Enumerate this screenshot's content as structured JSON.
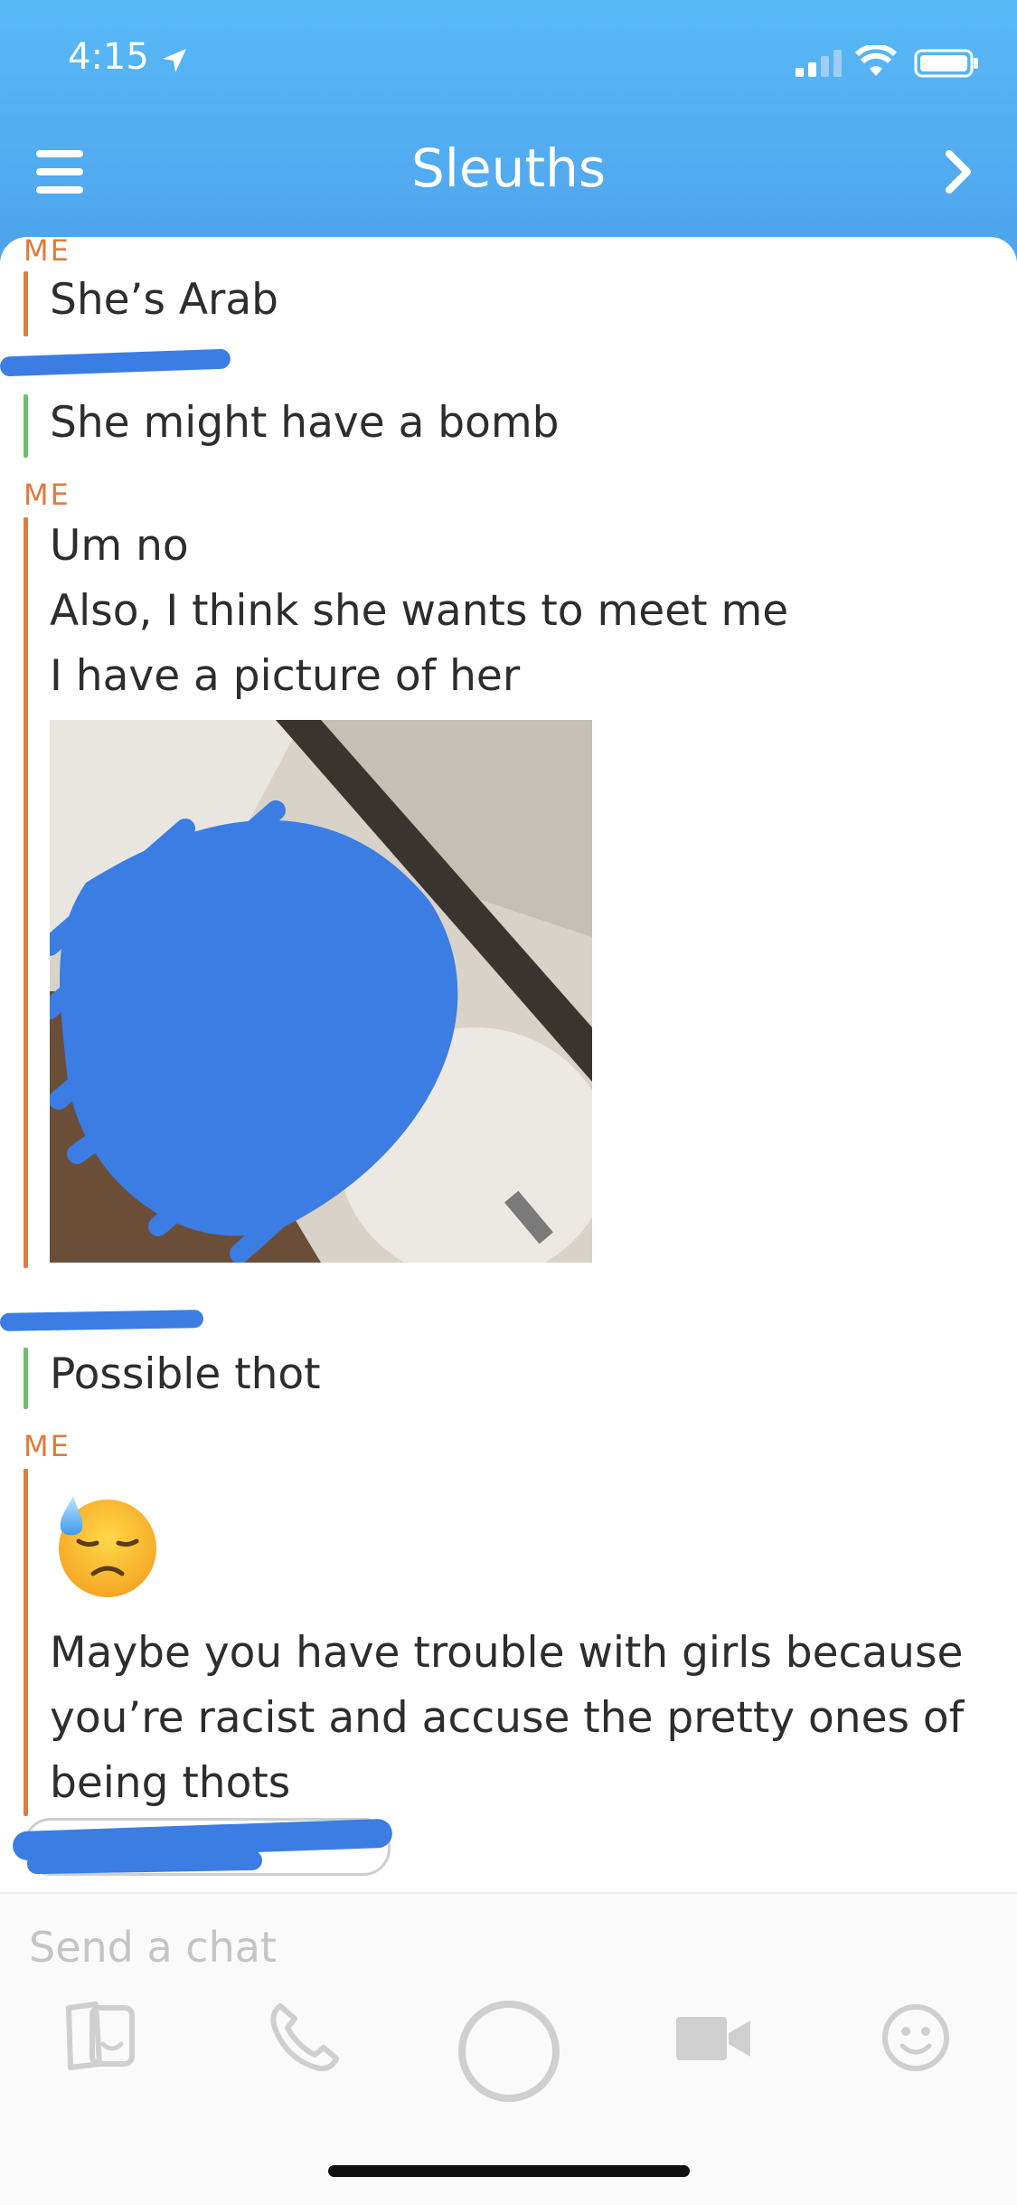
{
  "status_bar": {
    "time": "4:15"
  },
  "header": {
    "title": "Sleuths"
  },
  "messages": [
    {
      "sender": "ME",
      "lines": [
        "She’s Arab"
      ]
    },
    {
      "sender": "",
      "lines": [
        "She might have a bomb"
      ]
    },
    {
      "sender": "ME",
      "lines": [
        "Um no",
        "Also, I think she wants to meet me",
        "I have a picture of her"
      ]
    },
    {
      "sender": "",
      "lines": [
        "Possible thot"
      ]
    },
    {
      "sender": "ME",
      "lines": [
        "Maybe you have trouble with girls because",
        "you’re racist and accuse the pretty ones of",
        "being thots"
      ]
    }
  ],
  "input": {
    "placeholder": "Send a chat"
  },
  "colors": {
    "header": "#4ea3ec",
    "me": "#e07a3d",
    "friend": "#6bc16b",
    "scribble": "#3b7de3"
  },
  "icons": [
    "menu-icon",
    "chevron-right-icon",
    "cards-icon",
    "phone-icon",
    "capture-icon",
    "video-icon",
    "smiley-icon"
  ]
}
